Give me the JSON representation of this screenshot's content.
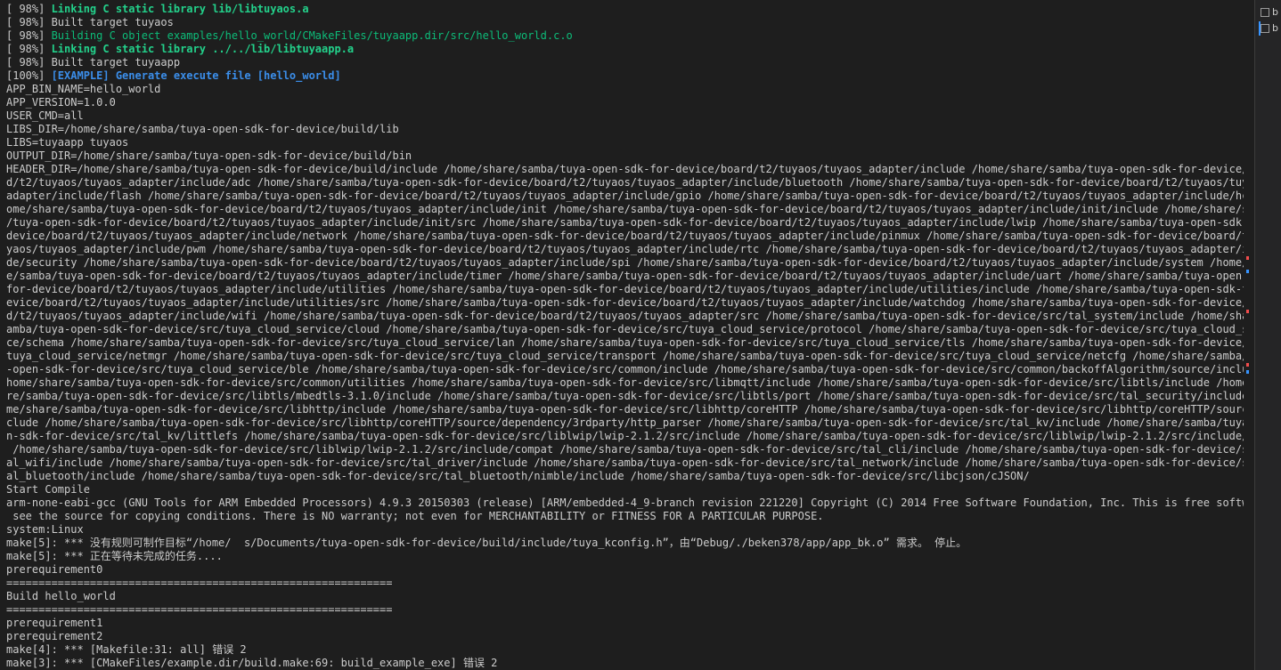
{
  "colors": {
    "background": "#1e1e1e",
    "text": "#cccccc",
    "green_bold": "#23d18b",
    "green": "#0dbc79",
    "blue_bold": "#3b8eea",
    "gutter_red": "#f14c4c",
    "gutter_blue": "#3794ff"
  },
  "terminal": {
    "lines": [
      {
        "text": "[ 98%] ",
        "rest": "Linking C static library lib/libtuyaos.a",
        "style": "green-bold"
      },
      {
        "text": "[ 98%] Built target tuyaos",
        "rest": "",
        "style": "plain"
      },
      {
        "text": "[ 98%] ",
        "rest": "Building C object examples/hello_world/CMakeFiles/tuyaapp.dir/src/hello_world.c.o",
        "style": "green"
      },
      {
        "text": "[ 98%] ",
        "rest": "Linking C static library ../../lib/libtuyaapp.a",
        "style": "green-bold"
      },
      {
        "text": "[ 98%] Built target tuyaapp",
        "rest": "",
        "style": "plain"
      },
      {
        "text": "[100%] ",
        "rest": "[EXAMPLE] Generate execute file [hello_world]",
        "style": "blue-bold"
      },
      {
        "text": "APP_BIN_NAME=hello_world",
        "rest": "",
        "style": "plain"
      },
      {
        "text": "APP_VERSION=1.0.0",
        "rest": "",
        "style": "plain"
      },
      {
        "text": "USER_CMD=all",
        "rest": "",
        "style": "plain"
      },
      {
        "text": "LIBS_DIR=/home/share/samba/tuya-open-sdk-for-device/build/lib",
        "rest": "",
        "style": "plain"
      },
      {
        "text": "LIBS=tuyaapp tuyaos",
        "rest": "",
        "style": "plain"
      },
      {
        "text": "OUTPUT_DIR=/home/share/samba/tuya-open-sdk-for-device/build/bin",
        "rest": "",
        "style": "plain"
      },
      {
        "text": "HEADER_DIR=/home/share/samba/tuya-open-sdk-for-device/build/include /home/share/samba/tuya-open-sdk-for-device/board/t2/tuyaos/tuyaos_adapter/include /home/share/samba/tuya-open-sdk-for-device/boar",
        "rest": "",
        "style": "plain"
      },
      {
        "text": "d/t2/tuyaos/tuyaos_adapter/include/adc /home/share/samba/tuya-open-sdk-for-device/board/t2/tuyaos/tuyaos_adapter/include/bluetooth /home/share/samba/tuya-open-sdk-for-device/board/t2/tuyaos/tuyaos_",
        "rest": "",
        "style": "plain"
      },
      {
        "text": "adapter/include/flash /home/share/samba/tuya-open-sdk-for-device/board/t2/tuyaos/tuyaos_adapter/include/gpio /home/share/samba/tuya-open-sdk-for-device/board/t2/tuyaos/tuyaos_adapter/include/hci /h",
        "rest": "",
        "style": "plain"
      },
      {
        "text": "ome/share/samba/tuya-open-sdk-for-device/board/t2/tuyaos/tuyaos_adapter/include/init /home/share/samba/tuya-open-sdk-for-device/board/t2/tuyaos/tuyaos_adapter/include/init/include /home/share/samba",
        "rest": "",
        "style": "plain"
      },
      {
        "text": "/tuya-open-sdk-for-device/board/t2/tuyaos/tuyaos_adapter/include/init/src /home/share/samba/tuya-open-sdk-for-device/board/t2/tuyaos/tuyaos_adapter/include/lwip /home/share/samba/tuya-open-sdk-for-",
        "rest": "",
        "style": "plain"
      },
      {
        "text": "device/board/t2/tuyaos/tuyaos_adapter/include/network /home/share/samba/tuya-open-sdk-for-device/board/t2/tuyaos/tuyaos_adapter/include/pinmux /home/share/samba/tuya-open-sdk-for-device/board/t2/tu",
        "rest": "",
        "style": "plain"
      },
      {
        "text": "yaos/tuyaos_adapter/include/pwm /home/share/samba/tuya-open-sdk-for-device/board/t2/tuyaos/tuyaos_adapter/include/rtc /home/share/samba/tuya-open-sdk-for-device/board/t2/tuyaos/tuyaos_adapter/inclu",
        "rest": "",
        "style": "plain"
      },
      {
        "text": "de/security /home/share/samba/tuya-open-sdk-for-device/board/t2/tuyaos/tuyaos_adapter/include/spi /home/share/samba/tuya-open-sdk-for-device/board/t2/tuyaos/tuyaos_adapter/include/system /home/shar",
        "rest": "",
        "style": "plain"
      },
      {
        "text": "e/samba/tuya-open-sdk-for-device/board/t2/tuyaos/tuyaos_adapter/include/timer /home/share/samba/tuya-open-sdk-for-device/board/t2/tuyaos/tuyaos_adapter/include/uart /home/share/samba/tuya-open-sdk-",
        "rest": "",
        "style": "plain"
      },
      {
        "text": "for-device/board/t2/tuyaos/tuyaos_adapter/include/utilities /home/share/samba/tuya-open-sdk-for-device/board/t2/tuyaos/tuyaos_adapter/include/utilities/include /home/share/samba/tuya-open-sdk-for-d",
        "rest": "",
        "style": "plain"
      },
      {
        "text": "evice/board/t2/tuyaos/tuyaos_adapter/include/utilities/src /home/share/samba/tuya-open-sdk-for-device/board/t2/tuyaos/tuyaos_adapter/include/watchdog /home/share/samba/tuya-open-sdk-for-device/boar",
        "rest": "",
        "style": "plain"
      },
      {
        "text": "d/t2/tuyaos/tuyaos_adapter/include/wifi /home/share/samba/tuya-open-sdk-for-device/board/t2/tuyaos/tuyaos_adapter/src /home/share/samba/tuya-open-sdk-for-device/src/tal_system/include /home/share/s",
        "rest": "",
        "style": "plain"
      },
      {
        "text": "amba/tuya-open-sdk-for-device/src/tuya_cloud_service/cloud /home/share/samba/tuya-open-sdk-for-device/src/tuya_cloud_service/protocol /home/share/samba/tuya-open-sdk-for-device/src/tuya_cloud_servi",
        "rest": "",
        "style": "plain"
      },
      {
        "text": "ce/schema /home/share/samba/tuya-open-sdk-for-device/src/tuya_cloud_service/lan /home/share/samba/tuya-open-sdk-for-device/src/tuya_cloud_service/tls /home/share/samba/tuya-open-sdk-for-device/src/",
        "rest": "",
        "style": "plain"
      },
      {
        "text": "tuya_cloud_service/netmgr /home/share/samba/tuya-open-sdk-for-device/src/tuya_cloud_service/transport /home/share/samba/tuya-open-sdk-for-device/src/tuya_cloud_service/netcfg /home/share/samba/tuya",
        "rest": "",
        "style": "plain"
      },
      {
        "text": "-open-sdk-for-device/src/tuya_cloud_service/ble /home/share/samba/tuya-open-sdk-for-device/src/common/include /home/share/samba/tuya-open-sdk-for-device/src/common/backoffAlgorithm/source/include /",
        "rest": "",
        "style": "plain"
      },
      {
        "text": "home/share/samba/tuya-open-sdk-for-device/src/common/utilities /home/share/samba/tuya-open-sdk-for-device/src/libmqtt/include /home/share/samba/tuya-open-sdk-for-device/src/libtls/include /home/sha",
        "rest": "",
        "style": "plain"
      },
      {
        "text": "re/samba/tuya-open-sdk-for-device/src/libtls/mbedtls-3.1.0/include /home/share/samba/tuya-open-sdk-for-device/src/libtls/port /home/share/samba/tuya-open-sdk-for-device/src/tal_security/include /ho",
        "rest": "",
        "style": "plain"
      },
      {
        "text": "me/share/samba/tuya-open-sdk-for-device/src/libhttp/include /home/share/samba/tuya-open-sdk-for-device/src/libhttp/coreHTTP /home/share/samba/tuya-open-sdk-for-device/src/libhttp/coreHTTP/source/in",
        "rest": "",
        "style": "plain"
      },
      {
        "text": "clude /home/share/samba/tuya-open-sdk-for-device/src/libhttp/coreHTTP/source/dependency/3rdparty/http_parser /home/share/samba/tuya-open-sdk-for-device/src/tal_kv/include /home/share/samba/tuya-ope",
        "rest": "",
        "style": "plain"
      },
      {
        "text": "n-sdk-for-device/src/tal_kv/littlefs /home/share/samba/tuya-open-sdk-for-device/src/liblwip/lwip-2.1.2/src/include /home/share/samba/tuya-open-sdk-for-device/src/liblwip/lwip-2.1.2/src/include/lwip",
        "rest": "",
        "style": "plain"
      },
      {
        "text": " /home/share/samba/tuya-open-sdk-for-device/src/liblwip/lwip-2.1.2/src/include/compat /home/share/samba/tuya-open-sdk-for-device/src/tal_cli/include /home/share/samba/tuya-open-sdk-for-device/src/t",
        "rest": "",
        "style": "plain"
      },
      {
        "text": "al_wifi/include /home/share/samba/tuya-open-sdk-for-device/src/tal_driver/include /home/share/samba/tuya-open-sdk-for-device/src/tal_network/include /home/share/samba/tuya-open-sdk-for-device/src/t",
        "rest": "",
        "style": "plain"
      },
      {
        "text": "al_bluetooth/include /home/share/samba/tuya-open-sdk-for-device/src/tal_bluetooth/nimble/include /home/share/samba/tuya-open-sdk-for-device/src/libcjson/cJSON/",
        "rest": "",
        "style": "plain"
      },
      {
        "text": "Start Compile",
        "rest": "",
        "style": "plain"
      },
      {
        "text": "arm-none-eabi-gcc (GNU Tools for ARM Embedded Processors) 4.9.3 20150303 (release) [ARM/embedded-4_9-branch revision 221220] Copyright (C) 2014 Free Software Foundation, Inc. This is free software;",
        "rest": "",
        "style": "plain"
      },
      {
        "text": " see the source for copying conditions. There is NO warranty; not even for MERCHANTABILITY or FITNESS FOR A PARTICULAR PURPOSE.",
        "rest": "",
        "style": "plain"
      },
      {
        "text": "system:Linux",
        "rest": "",
        "style": "plain"
      },
      {
        "text": "make[5]: *** 没有规则可制作目标“/home/  s/Documents/tuya-open-sdk-for-device/build/include/tuya_kconfig.h”，由“Debug/./beken378/app/app_bk.o” 需求。 停止。",
        "rest": "",
        "style": "plain"
      },
      {
        "text": "make[5]: *** 正在等待未完成的任务....",
        "rest": "",
        "style": "plain"
      },
      {
        "text": "prerequirement0",
        "rest": "",
        "style": "plain"
      },
      {
        "text": "============================================================",
        "rest": "",
        "style": "plain"
      },
      {
        "text": "Build hello_world",
        "rest": "",
        "style": "plain"
      },
      {
        "text": "============================================================",
        "rest": "",
        "style": "plain"
      },
      {
        "text": "prerequirement1",
        "rest": "",
        "style": "plain"
      },
      {
        "text": "prerequirement2",
        "rest": "",
        "style": "plain"
      },
      {
        "text": "make[4]: *** [Makefile:31: all] 错误 2",
        "rest": "",
        "style": "plain"
      },
      {
        "text": "make[3]: *** [CMakeFiles/example.dir/build.make:69: build_example_exe] 错误 2",
        "rest": "",
        "style": "plain"
      }
    ]
  },
  "side_panel": {
    "items": [
      {
        "label": "b",
        "active": false
      },
      {
        "label": "b",
        "active": true
      }
    ]
  },
  "gutter_marks": [
    {
      "line": 19,
      "color": "#f14c4c"
    },
    {
      "line": 20,
      "color": "#3794ff"
    },
    {
      "line": 23,
      "color": "#f14c4c"
    },
    {
      "line": 27,
      "color": "#f14c4c"
    },
    {
      "line": 27.5,
      "color": "#3794ff"
    }
  ]
}
